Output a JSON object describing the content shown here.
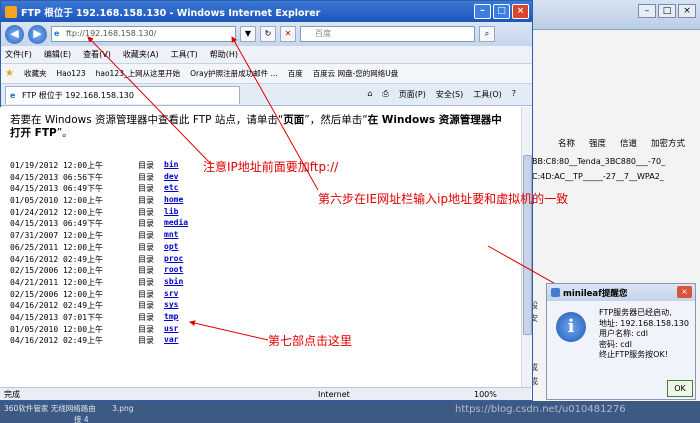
{
  "window": {
    "title": "FTP 根位于 192.168.158.130 - Windows Internet Explorer"
  },
  "address_bar": {
    "url": "ftp://192.168.158.130/",
    "search_placeholder": "百度"
  },
  "menu": [
    "文件(F)",
    "编辑(E)",
    "查看(V)",
    "收藏夹(A)",
    "工具(T)",
    "帮助(H)"
  ],
  "favorites_bar": [
    "收藏夹",
    "Hao123",
    "hao123_上网从这里开始",
    "Oray护照注册成功邮件 ...",
    "百度",
    "百度云 网盘-您的网络U盘"
  ],
  "tab": {
    "label": "FTP 根位于 192.168.158.130",
    "tools": [
      "页面(P)",
      "安全(S)",
      "工具(O)"
    ]
  },
  "content": {
    "intro_a": "若要在 Windows 资源管理器中查看此 FTP 站点，请单击“",
    "intro_page": "页面",
    "intro_b": "”，然后单击“",
    "intro_open": "在 Windows 资源管理器中打开 FTP",
    "intro_c": "”。",
    "listing": [
      {
        "date": "01/19/2012 12:00上午",
        "type": "目录",
        "name": "bin"
      },
      {
        "date": "04/15/2013 06:56下午",
        "type": "目录",
        "name": "dev"
      },
      {
        "date": "04/15/2013 06:49下午",
        "type": "目录",
        "name": "etc"
      },
      {
        "date": "01/05/2010 12:00上午",
        "type": "目录",
        "name": "home"
      },
      {
        "date": "01/24/2012 12:00上午",
        "type": "目录",
        "name": "lib"
      },
      {
        "date": "04/15/2013 06:49下午",
        "type": "目录",
        "name": "media"
      },
      {
        "date": "07/31/2007 12:00上午",
        "type": "目录",
        "name": "mnt"
      },
      {
        "date": "06/25/2011 12:00上午",
        "type": "目录",
        "name": "opt"
      },
      {
        "date": "04/16/2012 02:49上午",
        "type": "目录",
        "name": "proc"
      },
      {
        "date": "02/15/2006 12:00上午",
        "type": "目录",
        "name": "root"
      },
      {
        "date": "04/21/2011 12:00上午",
        "type": "目录",
        "name": "sbin"
      },
      {
        "date": "02/15/2006 12:00上午",
        "type": "目录",
        "name": "srv"
      },
      {
        "date": "04/16/2012 02:49上午",
        "type": "目录",
        "name": "sys"
      },
      {
        "date": "04/15/2013 07:01下午",
        "type": "目录",
        "name": "tmp"
      },
      {
        "date": "01/05/2010 12:00上午",
        "type": "目录",
        "name": "usr"
      },
      {
        "date": "04/16/2012 02:49上午",
        "type": "目录",
        "name": "var"
      }
    ]
  },
  "status": {
    "left": "完成",
    "zone": "Internet",
    "zoom": "100%"
  },
  "annotations": {
    "ftp_prefix": "注意IP地址前面要加ftp://",
    "step6": "第六步在IE网址栏输入ip地址要和虚拟机的一致",
    "step7": "第七部点击这里"
  },
  "wifi_list": {
    "headers": [
      "名称",
      "强度",
      "信道",
      "加密方式"
    ],
    "rows": [
      "BB:C8:80__Tenda_3BC880___-70_",
      "C:4D:AC__TP_____-27__7__WPA2_"
    ],
    "side_labels": [
      "设",
      "安",
      "成",
      "成"
    ]
  },
  "dialog": {
    "title": "minileaf提醒您",
    "lines": [
      "FTP服务器已经启动,",
      "地址: 192.168.158.130",
      "用户名称: cdl",
      "密码: cdl",
      "终止FTP服务按OK!"
    ],
    "ok_label": "OK"
  },
  "taskbar_text": [
    "360软件管家   无线网络路由",
    "接 4",
    "3.png"
  ],
  "watermark": "https://blog.csdn.net/u010481276",
  "colors": {
    "annotation": "#e00000",
    "link": "#0000cc"
  }
}
